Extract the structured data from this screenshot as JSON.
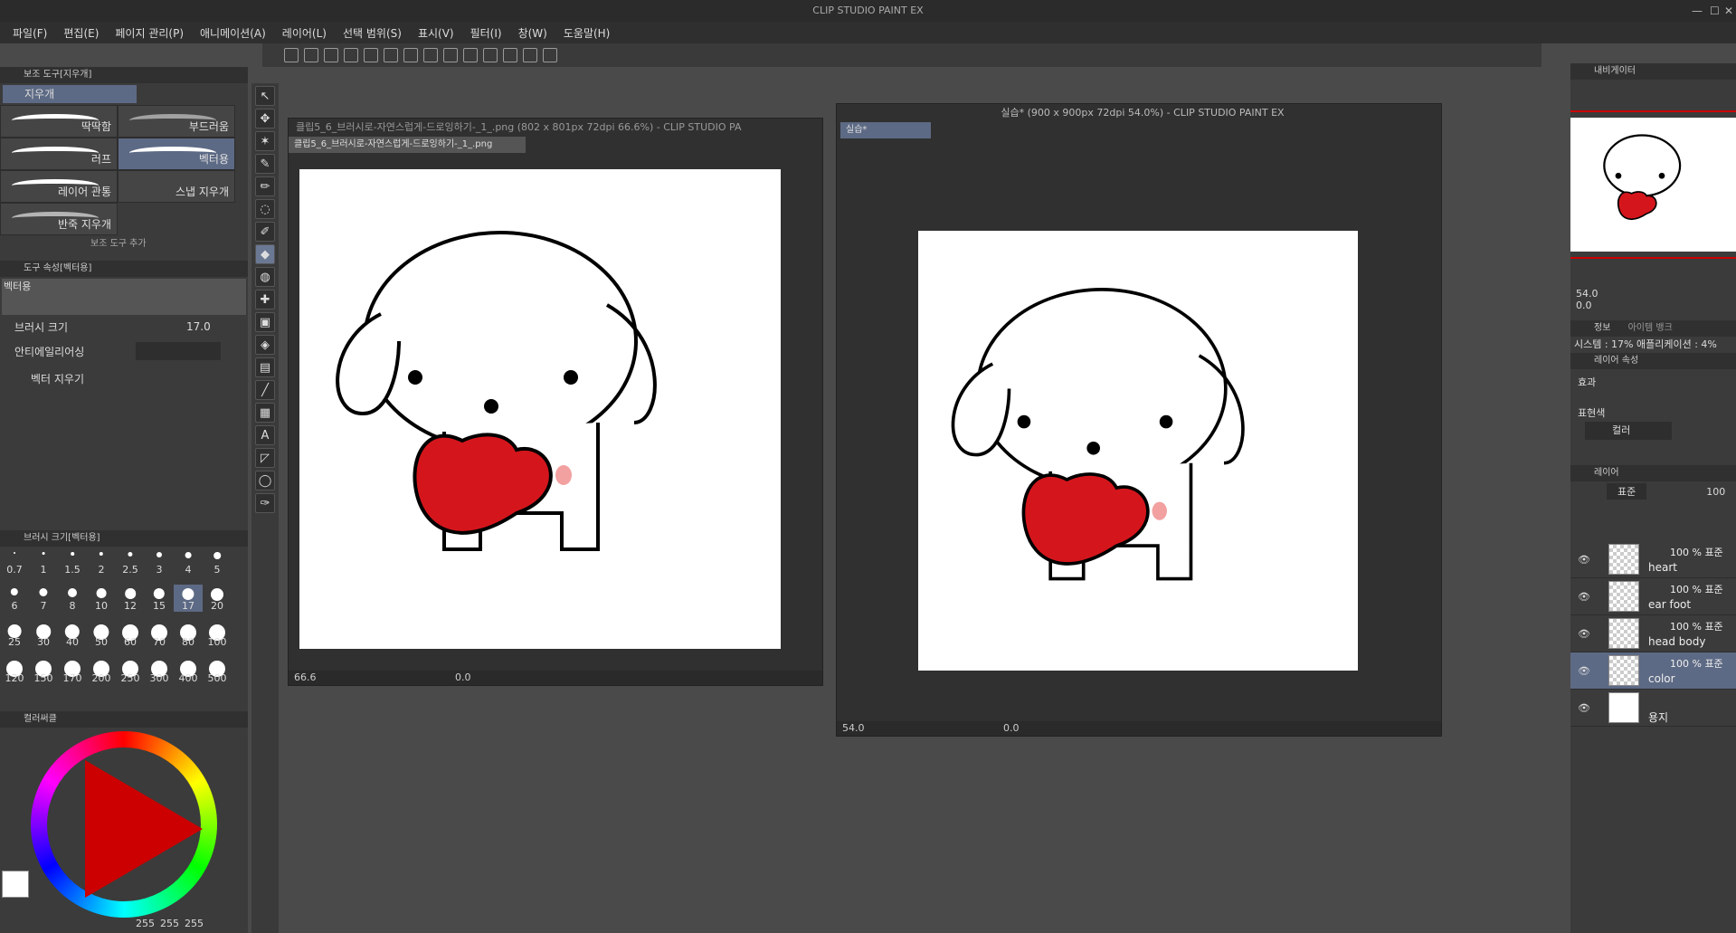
{
  "app": {
    "title": "CLIP STUDIO PAINT EX"
  },
  "menu": [
    "파일(F)",
    "편집(E)",
    "페이지 관리(P)",
    "애니메이션(A)",
    "레이어(L)",
    "선택 범위(S)",
    "표시(V)",
    "필터(I)",
    "창(W)",
    "도움말(H)"
  ],
  "subtool": {
    "header": "보조 도구[지우개]",
    "group": "지우개",
    "brushes": [
      "딱딱함",
      "부드러움",
      "러프",
      "벡터용",
      "레이어 관통",
      "스냅 지우개",
      "반죽 지우개"
    ],
    "selected": "벡터용",
    "footer": "보조 도구 추가"
  },
  "toolprop": {
    "header": "도구 속성[벡터용]",
    "preset_label": "벡터용",
    "brush_size_label": "브러시 크기",
    "brush_size_value": "17.0",
    "antialias_label": "안티에일리어싱",
    "vector_erase_label": "벡터 지우기"
  },
  "brushsize": {
    "header": "브러시 크기[벡터용]",
    "sizes": [
      "0.7",
      "1",
      "1.5",
      "2",
      "2.5",
      "3",
      "4",
      "5",
      "6",
      "7",
      "8",
      "10",
      "12",
      "15",
      "17",
      "20",
      "25",
      "30",
      "40",
      "50",
      "60",
      "70",
      "80",
      "100",
      "120",
      "150",
      "170",
      "200",
      "250",
      "300",
      "400",
      "500"
    ],
    "selected": "17"
  },
  "colorwheel": {
    "header": "컬러써클",
    "r": "255",
    "g": "255",
    "b": "255",
    "main_color": "#ffffff",
    "sub_color": "#d4161c"
  },
  "canvas1": {
    "title": "클립5_6_브러시로-자연스럽게-드로잉하기-_1_.png (802 x 801px 72dpi 66.6%)  - CLIP STUDIO PA",
    "tab": "클립5_6_브러시로-자연스럽게-드로잉하기-_1_.png",
    "zoom": "66.6",
    "angle": "0.0"
  },
  "canvas2": {
    "title": "실습* (900 x 900px 72dpi 54.0%) - CLIP STUDIO PAINT EX",
    "tab": "실습*",
    "zoom": "54.0",
    "angle": "0.0"
  },
  "navigator": {
    "header": "내비게이터",
    "zoom": "54.0",
    "angle": "0.0"
  },
  "info": {
    "header": "정보",
    "tab2": "아이템 뱅크",
    "system_line": "시스템 : 17% 애플리케이션 :  4%"
  },
  "layerprop": {
    "header": "레이어 속성",
    "effect_label": "효과",
    "color_label": "표현색",
    "color_value": "컬러"
  },
  "layers": {
    "header": "레이어",
    "blend": "표준",
    "opacity": "100",
    "items": [
      {
        "name": "heart",
        "mode": "100 % 표준"
      },
      {
        "name": "ear foot",
        "mode": "100 % 표준"
      },
      {
        "name": "head body",
        "mode": "100 % 표준"
      },
      {
        "name": "color",
        "mode": "100 % 표준"
      },
      {
        "name": "용지",
        "mode": ""
      }
    ]
  }
}
